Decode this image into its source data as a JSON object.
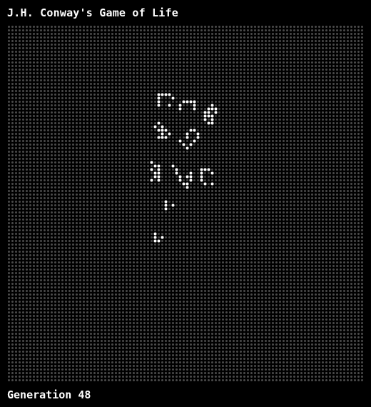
{
  "window": {
    "title": "J.H. Conway's Game of Life"
  },
  "status": {
    "generation_label": "Generation 48"
  },
  "colors": {
    "background": "#000000",
    "dead_cell": "#4a4a4a",
    "live_cell": "#ffffff",
    "text": "#ffffff"
  },
  "grid": {
    "columns": 100,
    "rows": 100,
    "live_cells": [
      [
        42,
        19
      ],
      [
        43,
        19
      ],
      [
        44,
        19
      ],
      [
        45,
        19
      ],
      [
        42,
        20
      ],
      [
        46,
        20
      ],
      [
        42,
        21
      ],
      [
        42,
        22
      ],
      [
        45,
        22
      ],
      [
        49,
        21
      ],
      [
        50,
        21
      ],
      [
        51,
        21
      ],
      [
        52,
        21
      ],
      [
        48,
        22
      ],
      [
        52,
        22
      ],
      [
        48,
        23
      ],
      [
        52,
        23
      ],
      [
        57,
        22
      ],
      [
        56,
        23
      ],
      [
        57,
        23
      ],
      [
        58,
        23
      ],
      [
        55,
        24
      ],
      [
        56,
        24
      ],
      [
        58,
        24
      ],
      [
        55,
        25
      ],
      [
        56,
        25
      ],
      [
        57,
        25
      ],
      [
        55,
        26
      ],
      [
        57,
        26
      ],
      [
        56,
        27
      ],
      [
        57,
        27
      ],
      [
        42,
        27
      ],
      [
        41,
        28
      ],
      [
        43,
        28
      ],
      [
        42,
        29
      ],
      [
        43,
        29
      ],
      [
        44,
        29
      ],
      [
        43,
        30
      ],
      [
        45,
        30
      ],
      [
        42,
        31
      ],
      [
        43,
        31
      ],
      [
        44,
        31
      ],
      [
        51,
        29
      ],
      [
        52,
        29
      ],
      [
        50,
        30
      ],
      [
        53,
        30
      ],
      [
        50,
        31
      ],
      [
        53,
        31
      ],
      [
        48,
        32
      ],
      [
        52,
        32
      ],
      [
        49,
        33
      ],
      [
        51,
        33
      ],
      [
        50,
        34
      ],
      [
        40,
        38
      ],
      [
        41,
        39
      ],
      [
        42,
        39
      ],
      [
        40,
        40
      ],
      [
        42,
        40
      ],
      [
        41,
        41
      ],
      [
        42,
        41
      ],
      [
        41,
        42
      ],
      [
        42,
        42
      ],
      [
        40,
        43
      ],
      [
        42,
        43
      ],
      [
        46,
        39
      ],
      [
        47,
        40
      ],
      [
        47,
        41
      ],
      [
        51,
        41
      ],
      [
        48,
        42
      ],
      [
        50,
        42
      ],
      [
        51,
        42
      ],
      [
        48,
        43
      ],
      [
        51,
        43
      ],
      [
        49,
        44
      ],
      [
        50,
        44
      ],
      [
        50,
        45
      ],
      [
        54,
        40
      ],
      [
        55,
        40
      ],
      [
        56,
        40
      ],
      [
        54,
        41
      ],
      [
        57,
        41
      ],
      [
        54,
        42
      ],
      [
        54,
        43
      ],
      [
        55,
        44
      ],
      [
        57,
        44
      ],
      [
        44,
        49
      ],
      [
        44,
        50
      ],
      [
        46,
        50
      ],
      [
        44,
        51
      ],
      [
        41,
        58
      ],
      [
        41,
        59
      ],
      [
        43,
        59
      ],
      [
        41,
        60
      ],
      [
        42,
        60
      ]
    ]
  }
}
